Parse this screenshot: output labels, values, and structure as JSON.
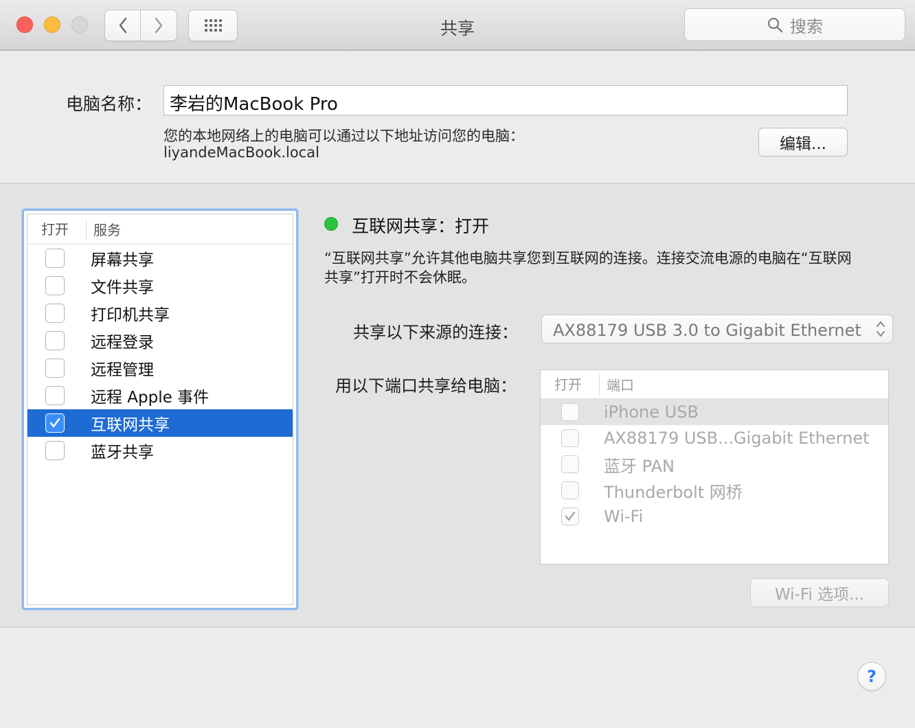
{
  "window": {
    "title": "共享",
    "search_placeholder": "搜索"
  },
  "computer": {
    "name_label": "电脑名称：",
    "name_value": "李岩的MacBook Pro",
    "address_note": "您的本地网络上的电脑可以通过以下地址访问您的电脑：",
    "address": "liyandeMacBook.local",
    "edit_label": "编辑..."
  },
  "services": {
    "header_on": "打开",
    "header_service": "服务",
    "items": [
      {
        "label": "屏幕共享",
        "checked": false
      },
      {
        "label": "文件共享",
        "checked": false
      },
      {
        "label": "打印机共享",
        "checked": false
      },
      {
        "label": "远程登录",
        "checked": false
      },
      {
        "label": "远程管理",
        "checked": false
      },
      {
        "label": "远程 Apple 事件",
        "checked": false
      },
      {
        "label": "互联网共享",
        "checked": true,
        "selected": true
      },
      {
        "label": "蓝牙共享",
        "checked": false
      }
    ]
  },
  "detail": {
    "status": "互联网共享：打开",
    "status_color": "#2cc33e",
    "description_line1": "“互联网共享”允许其他电脑共享您到互联网的连接。连接交流电源的电脑在“互联网",
    "description_line2": "共享”打开时不会休眠。",
    "source_label": "共享以下来源的连接：",
    "source_value": "AX88179 USB 3.0 to Gigabit Ethernet",
    "ports_label": "用以下端口共享给电脑：",
    "ports_header_on": "打开",
    "ports_header_port": "端口",
    "ports": [
      {
        "label": "iPhone USB",
        "checked": false
      },
      {
        "label": "AX88179 USB...Gigabit Ethernet",
        "checked": false
      },
      {
        "label": "蓝牙 PAN",
        "checked": false
      },
      {
        "label": "Thunderbolt 网桥",
        "checked": false
      },
      {
        "label": "Wi-Fi",
        "checked": true
      }
    ],
    "wifi_options_label": "Wi-Fi 选项..."
  },
  "help_label": "?"
}
